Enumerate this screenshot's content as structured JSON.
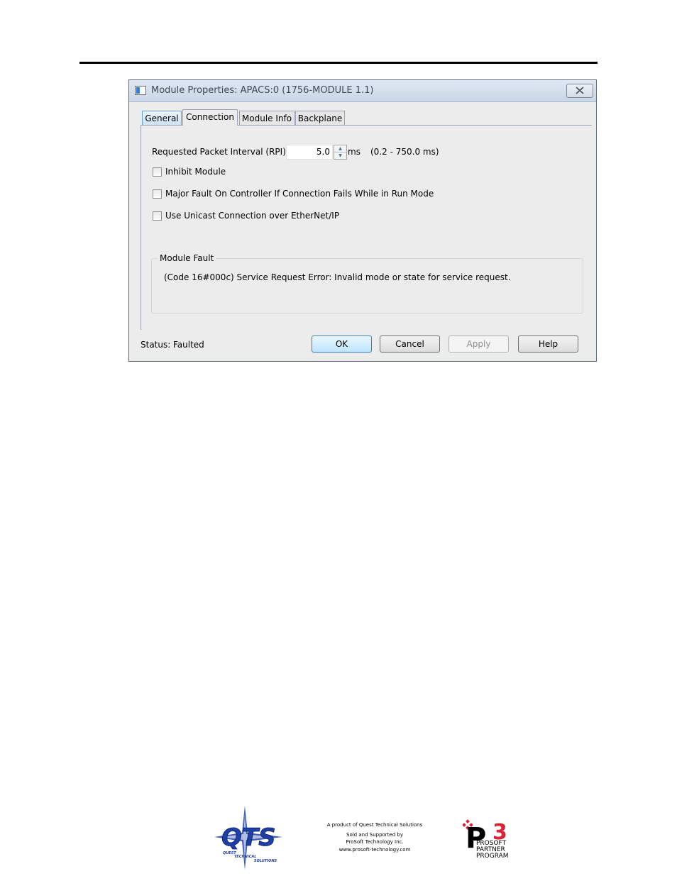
{
  "dialog": {
    "title": "Module Properties: APACS:0 (1756-MODULE 1.1)",
    "tabs": [
      {
        "label": "General",
        "active": false
      },
      {
        "label": "Connection",
        "active": true
      },
      {
        "label": "Module Info",
        "active": false
      },
      {
        "label": "Backplane",
        "active": false
      }
    ],
    "rpi": {
      "label": "Requested Packet Interval (RPI):",
      "value": "5.0",
      "unit": "ms",
      "range": "(0.2 - 750.0 ms)"
    },
    "checkboxes": [
      {
        "label": "Inhibit Module",
        "checked": false
      },
      {
        "label": "Major Fault On Controller If Connection Fails While in Run Mode",
        "checked": false
      },
      {
        "label": "Use Unicast Connection over EtherNet/IP",
        "checked": false
      }
    ],
    "module_fault": {
      "title": "Module Fault",
      "message": "(Code 16#000c) Service Request Error: Invalid mode or state for service request."
    },
    "status": {
      "label": "Status:",
      "value": "Faulted"
    },
    "buttons": {
      "ok": "OK",
      "cancel": "Cancel",
      "apply": "Apply",
      "help": "Help"
    }
  },
  "footer": {
    "qts_logo": "QTS",
    "qts_tagline": "Quest Technical Solutions",
    "lines": [
      "A product of Quest Technical Solutions",
      "Sold and Supported by",
      "ProSoft Technology Inc.",
      "www.prosoft-technology.com"
    ],
    "p3_logo": {
      "mark": "P3",
      "lines": [
        "PROSOFT",
        "PARTNER",
        "PROGRAM"
      ]
    },
    "colors": {
      "qts_blue": "#1f3fa8",
      "p3_red": "#d8253a"
    }
  }
}
